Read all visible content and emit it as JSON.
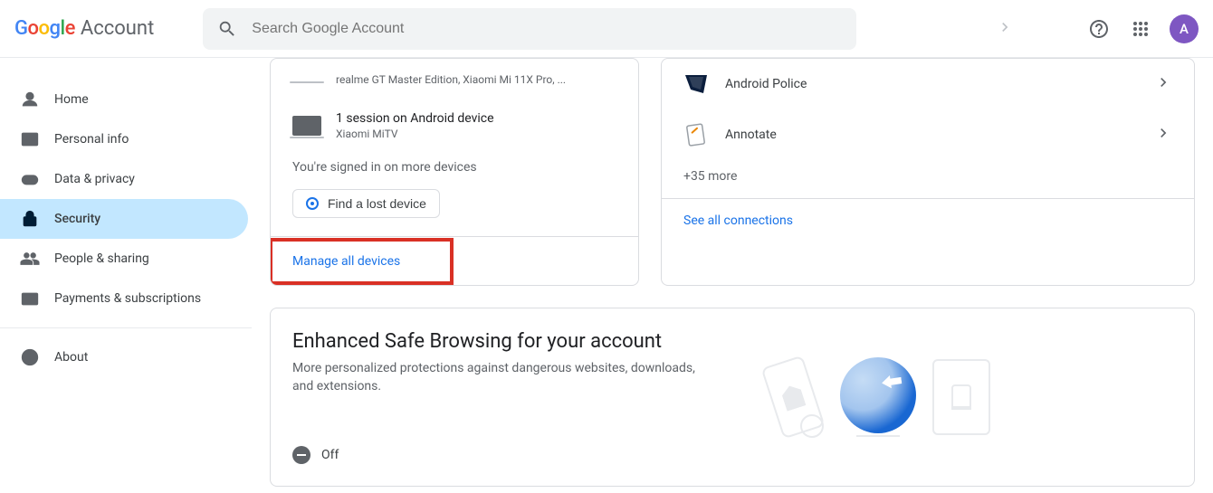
{
  "header": {
    "brand_account": "Account",
    "search_placeholder": "Search Google Account",
    "avatar_letter": "A"
  },
  "sidebar": {
    "items": [
      {
        "label": "Home"
      },
      {
        "label": "Personal info"
      },
      {
        "label": "Data & privacy"
      },
      {
        "label": "Security"
      },
      {
        "label": "People & sharing"
      },
      {
        "label": "Payments & subscriptions"
      },
      {
        "label": "About"
      }
    ]
  },
  "devices": {
    "row0_sub": "realme GT Master Edition, Xiaomi Mi 11X Pro, ...",
    "row1_title": "1 session on Android device",
    "row1_sub": "Xiaomi MiTV",
    "more_sessions": "You're signed in on more devices",
    "find_lost": "Find a lost device",
    "manage_all": "Manage all devices"
  },
  "connections": {
    "row0_label": "Android Police",
    "row1_label": "Annotate",
    "more_count": "+35 more",
    "see_all": "See all connections"
  },
  "safebrowsing": {
    "title": "Enhanced Safe Browsing for your account",
    "description": "More personalized protections against dangerous websites, downloads, and extensions.",
    "status_label": "Off"
  }
}
